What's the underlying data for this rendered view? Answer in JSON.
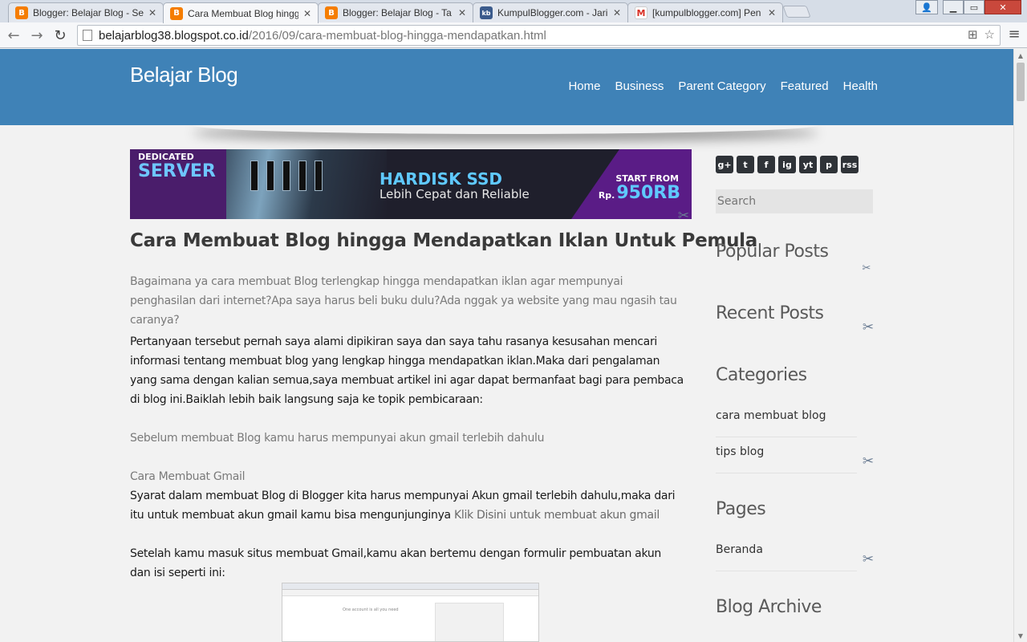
{
  "browser": {
    "tabs": [
      {
        "title": "Blogger: Belajar Blog - Se",
        "close": "✕",
        "icon": "blogger-icon"
      },
      {
        "title": "Cara Membuat Blog hingg",
        "close": "✕",
        "icon": "blogger-icon"
      },
      {
        "title": "Blogger: Belajar Blog - Ta",
        "close": "✕",
        "icon": "blogger-icon"
      },
      {
        "title": "KumpulBlogger.com - Jari",
        "close": "✕",
        "icon": "kb-icon"
      },
      {
        "title": "[kumpulblogger.com] Pen",
        "close": "✕",
        "icon": "gmail-icon"
      }
    ],
    "address": {
      "host": "belajarblog38.blogspot.co.id",
      "path": "/2016/09/cara-membuat-blog-hingga-mendapatkan.html"
    }
  },
  "site": {
    "title": "Belajar Blog",
    "nav": [
      "Home",
      "Business",
      "Parent Category",
      "Featured",
      "Health"
    ]
  },
  "banner": {
    "tag_top": "DEDICATED",
    "tag_big": "SERVER",
    "headline": "HARDISK SSD",
    "subline": "Lebih Cepat dan Reliable",
    "start": "START FROM",
    "currency": "Rp.",
    "price": "950RB"
  },
  "post": {
    "title": "Cara Membuat Blog hingga Mendapatkan Iklan Untuk Pemula",
    "intro": "Bagaimana ya cara membuat Blog terlengkap hingga mendapatkan iklan agar mempunyai penghasilan dari internet?Apa saya harus beli buku dulu?Ada nggak ya website yang mau ngasih tau caranya?",
    "p1": "Pertanyaan tersebut pernah saya alami dipikiran saya dan saya tahu rasanya kesusahan mencari informasi tentang membuat blog yang lengkap hingga mendapatkan iklan.Maka dari pengalaman yang sama dengan kalian semua,saya membuat artikel ini agar dapat bermanfaat bagi para pembaca di blog ini.Baiklah lebih baik langsung saja ke topik pembicaraan:",
    "p2": "Sebelum membuat Blog kamu harus mempunyai akun gmail terlebih dahulu",
    "h_gmail": "Cara Membuat Gmail",
    "p3_text": "Syarat dalam membuat Blog di Blogger kita harus mempunyai Akun gmail terlebih dahulu,maka dari itu untuk membuat akun gmail kamu bisa mengunjunginya ",
    "p3_link": "Klik Disini untuk membuat akun gmail",
    "p4": "Setelah kamu masuk situs membuat Gmail,kamu akan bertemu dengan formulir pembuatan akun dan isi seperti ini:",
    "screenshot_text": "One account is all you need"
  },
  "sidebar": {
    "social": [
      "g+",
      "t",
      "f",
      "ig",
      "yt",
      "p",
      "rss"
    ],
    "search_placeholder": "Search",
    "popular_title": "Popular Posts",
    "recent_title": "Recent Posts",
    "categories_title": "Categories",
    "categories": [
      "cara membuat blog",
      "tips blog"
    ],
    "pages_title": "Pages",
    "pages": [
      "Beranda"
    ],
    "archive_title": "Blog Archive"
  }
}
